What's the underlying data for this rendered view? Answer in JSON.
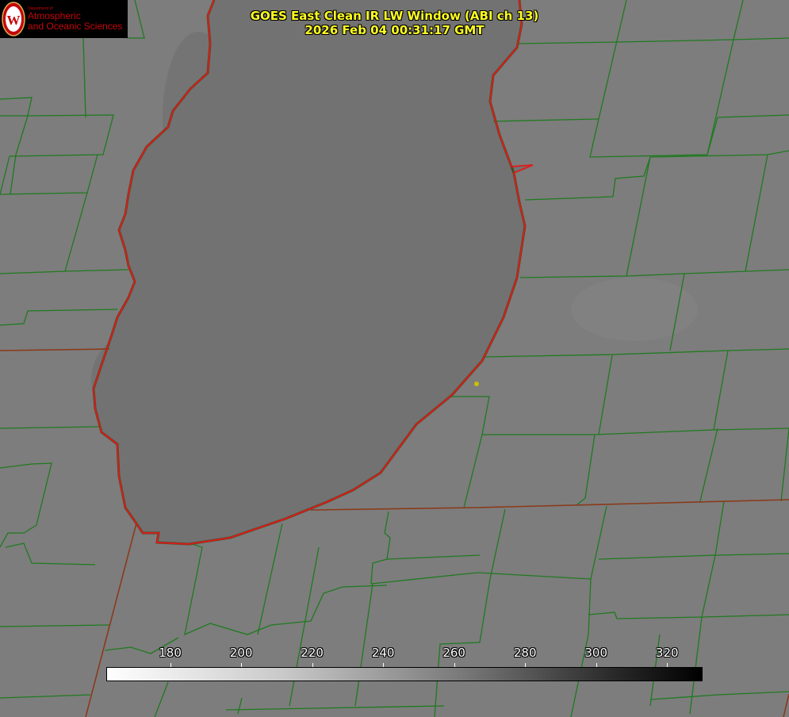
{
  "header": {
    "line1": "GOES East Clean IR LW Window (ABI ch 13)",
    "line2": "2026 Feb 04 00:31:17 GMT"
  },
  "logo": {
    "dept": "Department of",
    "line1": "Atmospheric",
    "line2": "and Oceanic Sciences",
    "seal_letter": "W",
    "brand_color": "#c5050c"
  },
  "colorbar": {
    "ticks": [
      "180",
      "200",
      "220",
      "240",
      "260",
      "280",
      "300",
      "320"
    ],
    "tick_values": [
      180,
      200,
      220,
      240,
      260,
      280,
      300,
      320
    ],
    "range": [
      162,
      330
    ],
    "palette": "white-to-black"
  },
  "colors": {
    "background": "#7d7d7d",
    "lake": "#727272",
    "county_lines": "#1f7a1f",
    "state_lines": "#8a3a1a",
    "shoreline": "#e11a1a",
    "title": "#ffff22",
    "marker": "#c8c000"
  }
}
